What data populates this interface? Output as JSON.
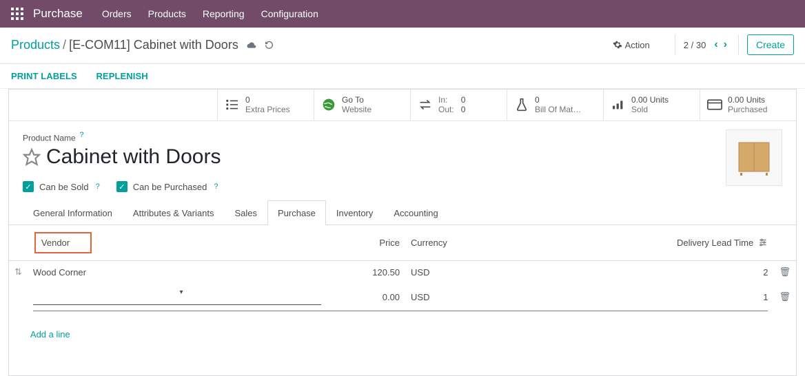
{
  "nav": {
    "brand": "Purchase",
    "items": [
      "Orders",
      "Products",
      "Reporting",
      "Configuration"
    ]
  },
  "breadcrumb": {
    "back": "Products",
    "current": "[E-COM11] Cabinet with Doors",
    "action": "Action",
    "pager": "2 / 30",
    "create": "Create"
  },
  "action_links": {
    "print_labels": "PRINT LABELS",
    "replenish": "REPLENISH"
  },
  "stats": {
    "extra_prices": {
      "value": "0",
      "label": "Extra Prices"
    },
    "website": {
      "line1": "Go To",
      "line2": "Website"
    },
    "transfers": {
      "in_label": "In:",
      "in_value": "0",
      "out_label": "Out:",
      "out_value": "0"
    },
    "bom": {
      "value": "0",
      "label": "Bill Of Mat…"
    },
    "sold": {
      "value": "0.00 Units",
      "label": "Sold"
    },
    "purchased": {
      "value": "0.00 Units",
      "label": "Purchased"
    }
  },
  "product": {
    "name_label": "Product Name",
    "name": "Cabinet with Doors",
    "can_be_sold": "Can be Sold",
    "can_be_purchased": "Can be Purchased"
  },
  "tabs": {
    "general": "General Information",
    "attrs": "Attributes & Variants",
    "sales": "Sales",
    "purchase": "Purchase",
    "inventory": "Inventory",
    "accounting": "Accounting"
  },
  "table": {
    "headers": {
      "vendor": "Vendor",
      "price": "Price",
      "currency": "Currency",
      "dlt": "Delivery Lead Time"
    },
    "rows": [
      {
        "vendor": "Wood Corner",
        "price": "120.50",
        "currency": "USD",
        "dlt": "2"
      },
      {
        "vendor": "",
        "price": "0.00",
        "currency": "USD",
        "dlt": "1"
      }
    ],
    "add_line": "Add a line"
  }
}
